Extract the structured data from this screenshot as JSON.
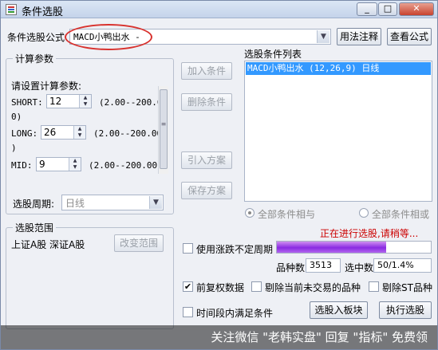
{
  "window": {
    "title": "条件选股",
    "controls": [
      "_",
      "□",
      "✕"
    ]
  },
  "formula": {
    "label": "条件选股公式",
    "value": "MACD小鸭出水 -",
    "usage_button": "用法注释",
    "view_button": "查看公式"
  },
  "params": {
    "group_title": "计算参数",
    "prompt": "请设置计算参数:",
    "items": [
      {
        "name": "SHORT:",
        "value": "12",
        "range": "(2.00--200.0",
        "wrap": "0)"
      },
      {
        "name": "LONG:",
        "value": "26",
        "range": "(2.00--200.00",
        "wrap": ")"
      },
      {
        "name": "MID:",
        "value": "9",
        "range": "(2.00--200.00)"
      }
    ]
  },
  "period": {
    "label": "选股周期:",
    "value": "日线"
  },
  "scope": {
    "group_title": "选股范围",
    "value": "上证A股 深证A股",
    "change_button": "改变范围"
  },
  "actions": {
    "add": "加入条件",
    "delete": "删除条件",
    "import": "引入方案",
    "save": "保存方案"
  },
  "condition_list": {
    "label": "选股条件列表",
    "items": [
      "MACD小鸭出水 (12,26,9) 日线"
    ]
  },
  "logic": {
    "and_label": "全部条件相与",
    "or_label": "全部条件相或"
  },
  "status": {
    "message": "正在进行选股,请稍等...",
    "progress_percent": 71
  },
  "options": {
    "indefinite_period": "使用涨跌不定周期",
    "variety_label": "品种数",
    "variety_value": "3513",
    "selected_label": "选中数",
    "selected_value": "50/1.4%",
    "pre_adjust": "前复权数据",
    "exclude_untraded": "剔除当前未交易的品种",
    "exclude_st": "剔除ST品种",
    "time_range": "时间段内满足条件"
  },
  "buttons": {
    "to_block": "选股入板块",
    "execute": "执行选股"
  },
  "watermark": "关注微信 \"老韩实盘\" 回复 \"指标\" 免费领",
  "colors": {
    "accent": "#3399ff",
    "status_red": "#cc0000",
    "progress_purple": "#8a2be2",
    "annotation_red": "#d8322e"
  }
}
